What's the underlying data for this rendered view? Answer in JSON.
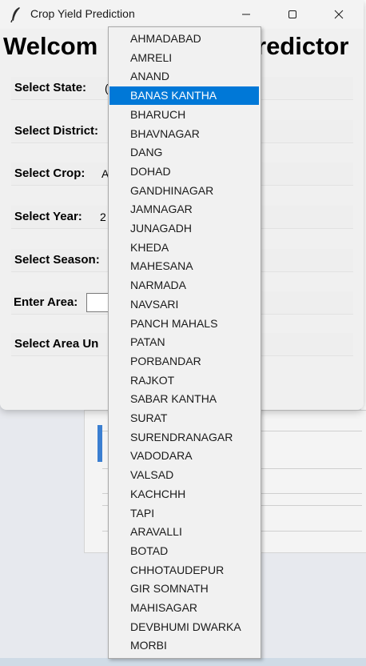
{
  "window": {
    "title": "Crop Yield Prediction"
  },
  "main": {
    "heading_left": "Welcom",
    "heading_right": "redictor",
    "fields": [
      {
        "label": "Select State:",
        "value_fragment": "("
      },
      {
        "label": "Select District:",
        "value_fragment": ""
      },
      {
        "label": "Select Crop:",
        "value_fragment": "A"
      },
      {
        "label": "Select Year:",
        "value_fragment": "2"
      },
      {
        "label": "Select Season:",
        "value_fragment": ""
      },
      {
        "label": "Enter Area:",
        "value_fragment": ""
      },
      {
        "label": "Select Area Un",
        "value_fragment": ""
      }
    ]
  },
  "dropdown": {
    "selected": "BANAS KANTHA",
    "items": [
      "AHMADABAD",
      "AMRELI",
      "ANAND",
      "BANAS KANTHA",
      "BHARUCH",
      "BHAVNAGAR",
      "DANG",
      "DOHAD",
      "GANDHINAGAR",
      "JAMNAGAR",
      "JUNAGADH",
      "KHEDA",
      "MAHESANA",
      "NARMADA",
      "NAVSARI",
      "PANCH MAHALS",
      "PATAN",
      "PORBANDAR",
      "RAJKOT",
      "SABAR KANTHA",
      "SURAT",
      "SURENDRANAGAR",
      "VADODARA",
      "VALSAD",
      "KACHCHH",
      "TAPI",
      "ARAVALLI",
      "BOTAD",
      "CHHOTAUDEPUR",
      "GIR SOMNATH",
      "MAHISAGAR",
      "DEVBHUMI DWARKA",
      "MORBI"
    ]
  },
  "icons": {
    "app": "feather-icon",
    "minimize": "minimize-icon",
    "maximize": "maximize-icon",
    "close": "close-icon"
  },
  "colors": {
    "selection": "#0078d7",
    "accent_background_bar": "#3b7fd1"
  }
}
